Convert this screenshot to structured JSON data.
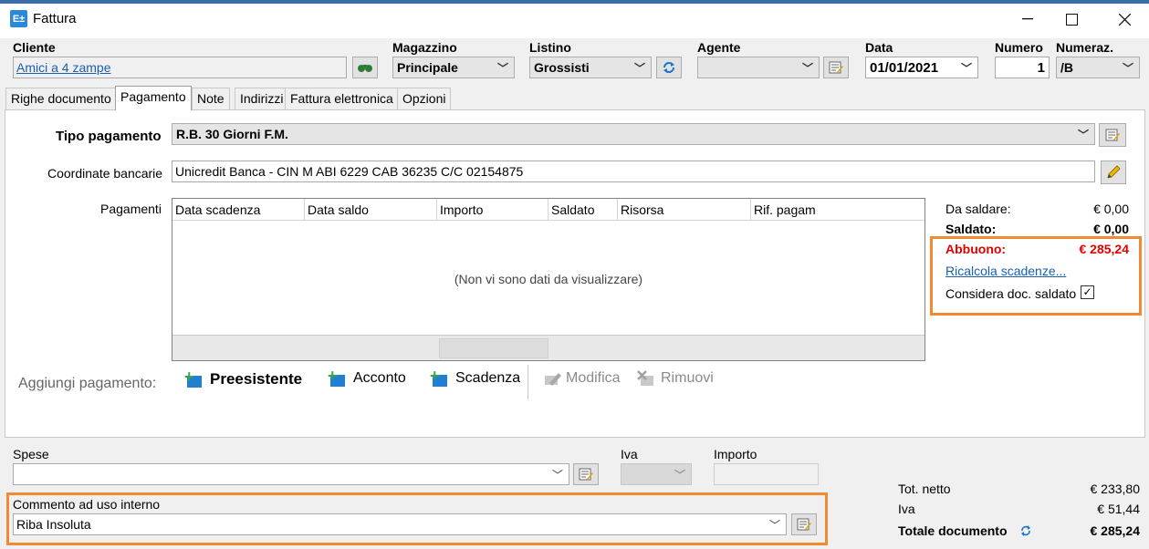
{
  "window": {
    "title": "Fattura",
    "icon": "E±"
  },
  "header": {
    "cliente": {
      "label": "Cliente",
      "value": "Amici a 4 zampe"
    },
    "magazzino": {
      "label": "Magazzino",
      "value": "Principale"
    },
    "listino": {
      "label": "Listino",
      "value": "Grossisti"
    },
    "agente": {
      "label": "Agente",
      "value": ""
    },
    "data": {
      "label": "Data",
      "value": "01/01/2021"
    },
    "numero": {
      "label": "Numero",
      "value": "1"
    },
    "numeraz": {
      "label": "Numeraz.",
      "value": "/B"
    }
  },
  "tabs": [
    {
      "label": "Righe documento"
    },
    {
      "label": "Pagamento"
    },
    {
      "label": "Note"
    },
    {
      "label": "Indirizzi"
    },
    {
      "label": "Fattura elettronica"
    },
    {
      "label": "Opzioni"
    }
  ],
  "pagamento": {
    "tipo_label": "Tipo pagamento",
    "tipo_value": "R.B. 30 Giorni F.M.",
    "coordinate_label": "Coordinate bancarie",
    "coordinate_value": "Unicredit Banca - CIN M  ABI 6229  CAB 36235  C/C 02154875",
    "pagamenti_label": "Pagamenti",
    "columns": [
      "Data scadenza",
      "Data saldo",
      "Importo",
      "Saldato",
      "Risorsa",
      "Rif. pagam"
    ],
    "empty_text": "(Non vi sono dati da visualizzare)"
  },
  "summary": {
    "da_saldare_label": "Da saldare:",
    "da_saldare_value": "€ 0,00",
    "saldato_label": "Saldato:",
    "saldato_value": "€ 0,00",
    "abbuono_label": "Abbuono:",
    "abbuono_value": "€ 285,24",
    "ricalcola_link": "Ricalcola scadenze...",
    "considera_label": "Considera doc. saldato",
    "considera_checked": true
  },
  "toolbar": {
    "aggiungi_label": "Aggiungi pagamento:",
    "preesistente": "Preesistente",
    "acconto": "Acconto",
    "scadenza": "Scadenza",
    "modifica": "Modifica",
    "rimuovi": "Rimuovi"
  },
  "footer": {
    "spese_label": "Spese",
    "spese_value": "",
    "iva_label": "Iva",
    "importo_label": "Importo",
    "commento_label": "Commento ad uso interno",
    "commento_value": "Riba Insoluta"
  },
  "totals": {
    "netto_label": "Tot. netto",
    "netto_value": "€ 233,80",
    "iva_label": "Iva",
    "iva_value": "€ 51,44",
    "totale_label": "Totale documento",
    "totale_value": "€ 285,24"
  },
  "colors": {
    "accent_orange": "#f28a2f",
    "abbuono_red": "#e00000",
    "link_blue": "#1a5fb4"
  }
}
